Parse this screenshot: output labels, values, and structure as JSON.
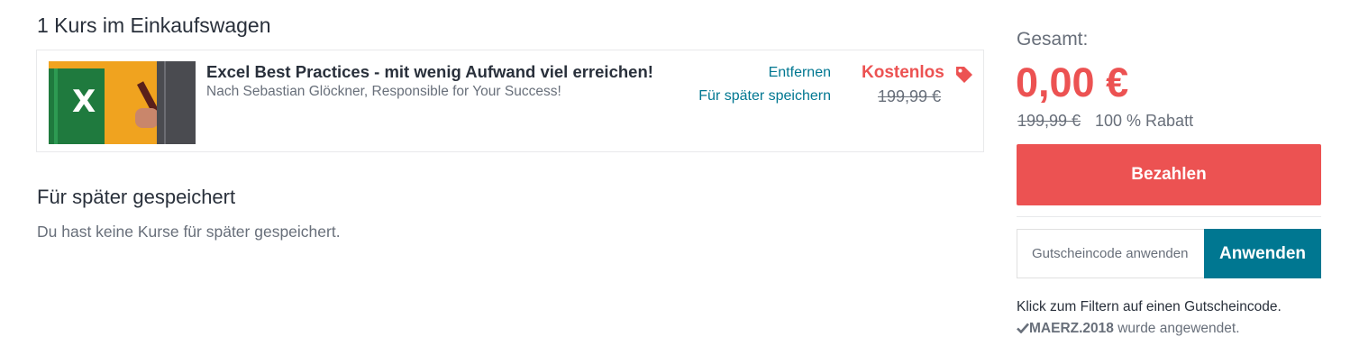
{
  "cart": {
    "heading": "1 Kurs im Einkaufswagen",
    "items": [
      {
        "title": "Excel Best Practices - mit wenig Aufwand viel erreichen!",
        "author": "Nach Sebastian Glöckner, Responsible for Your Success!",
        "remove_label": "Entfernen",
        "save_later_label": "Für später speichern",
        "price_label": "Kostenlos",
        "original_price": "199,99 €",
        "thumbnail_icon": "excel-course-thumbnail",
        "thumbnail_letter": "X"
      }
    ]
  },
  "saved_for_later": {
    "heading": "Für später gespeichert",
    "empty_message": "Du hast keine Kurse für später gespeichert."
  },
  "summary": {
    "total_label": "Gesamt:",
    "total_price": "0,00 €",
    "original_price": "199,99 €",
    "discount": "100 % Rabatt",
    "pay_label": "Bezahlen"
  },
  "coupon": {
    "placeholder": "Gutscheincode anwenden",
    "apply_label": "Anwenden",
    "hint": "Klick zum Filtern auf einen Gutscheincode.",
    "applied_code": "MAERZ.2018",
    "applied_suffix": " wurde angewendet."
  },
  "colors": {
    "accent_red": "#ec5252",
    "accent_teal": "#007791",
    "text_dark": "#29303b",
    "text_muted": "#686f7a"
  }
}
